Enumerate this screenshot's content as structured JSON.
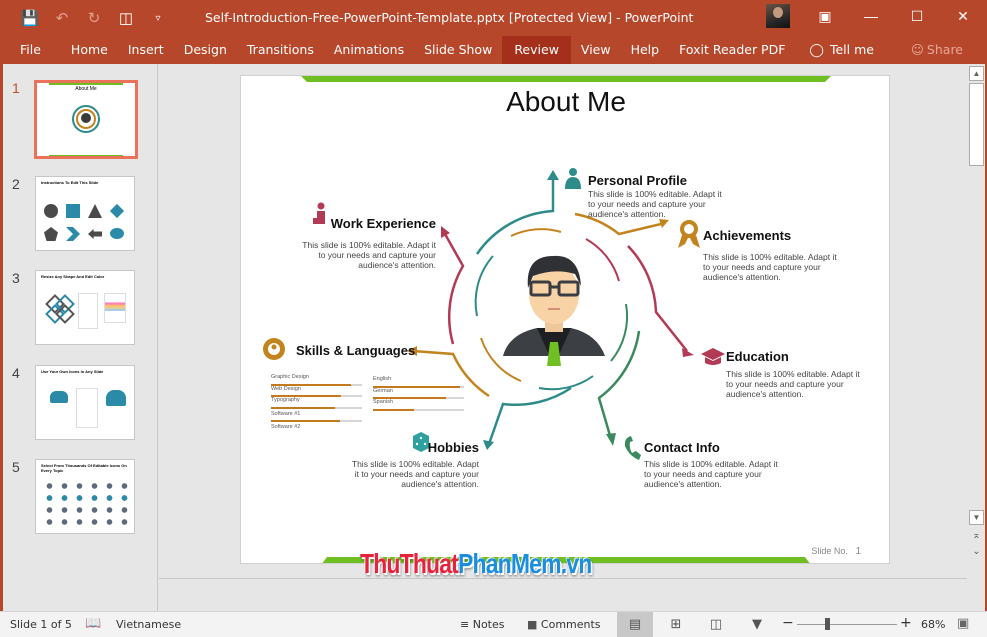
{
  "window": {
    "title": "Self-Introduction-Free-PowerPoint-Template.pptx [Protected View]  -  PowerPoint",
    "controls": [
      "ribbon-display-options",
      "minimize",
      "maximize",
      "close"
    ]
  },
  "quick_access": [
    "save",
    "undo",
    "redo",
    "start-from-beginning",
    "customize"
  ],
  "ribbon": {
    "tabs": [
      "File",
      "Home",
      "Insert",
      "Design",
      "Transitions",
      "Animations",
      "Slide Show",
      "Review",
      "View",
      "Help",
      "Foxit Reader PDF"
    ],
    "active_tab": "Review",
    "tell_me": "Tell me",
    "share": "Share"
  },
  "thumbnails": [
    {
      "number": "1",
      "title": "About Me",
      "selected": true
    },
    {
      "number": "2",
      "title": "Instructions To Edit This Slide",
      "selected": false
    },
    {
      "number": "3",
      "title": "Resize Any Shape And Edit Color",
      "selected": false
    },
    {
      "number": "4",
      "title": "Use Your Own Icons In Any Slide",
      "selected": false
    },
    {
      "number": "5",
      "title": "Select From Thousands Of Editable Icons On Every Topic",
      "selected": false
    }
  ],
  "slide": {
    "title": "About Me",
    "body_text": "This slide is 100% editable. Adapt it to your needs and capture your audience's attention.",
    "sections": {
      "personal_profile": {
        "heading": "Personal Profile",
        "color": "#2f8a8a"
      },
      "work_experience": {
        "heading": "Work Experience",
        "color": "#b23a55"
      },
      "achievements": {
        "heading": "Achievements",
        "color": "#c3841e"
      },
      "skills_languages": {
        "heading": "Skills & Languages",
        "color": "#c3841e"
      },
      "education": {
        "heading": "Education",
        "color": "#b23a55"
      },
      "hobbies": {
        "heading": "Hobbies",
        "color": "#2f9a9a"
      },
      "contact_info": {
        "heading": "Contact Info",
        "color": "#3a8a5e"
      }
    },
    "skills": [
      {
        "label": "Graphic Design",
        "level": 0.88
      },
      {
        "label": "Web Design",
        "level": 0.77
      },
      {
        "label": "Typography",
        "level": 0.7
      },
      {
        "label": "Software #1",
        "level": 0.76
      },
      {
        "label": "Software #2",
        "level": 0.0
      }
    ],
    "languages": [
      {
        "label": "English",
        "level": 0.96
      },
      {
        "label": "German",
        "level": 0.8
      },
      {
        "label": "Spanish",
        "level": 0.45
      }
    ],
    "slide_number_label": "Slide No.",
    "slide_number": "1",
    "accent_green": "#6fbf22"
  },
  "watermark": {
    "part1": "ThuThuat",
    "part2": "PhanMem",
    "part3": ".vn"
  },
  "status": {
    "slide_indicator": "Slide 1 of 5",
    "language": "Vietnamese",
    "notes": "Notes",
    "comments": "Comments",
    "zoom_level": "68%",
    "zoom_fraction": 0.68
  }
}
